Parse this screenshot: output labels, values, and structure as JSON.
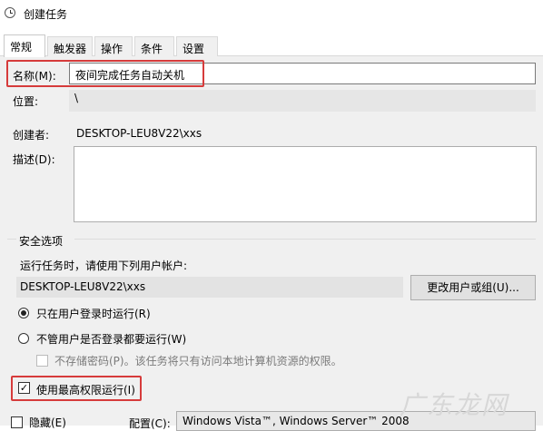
{
  "window": {
    "title": "创建任务"
  },
  "tabs": [
    {
      "label": "常规",
      "active": true
    },
    {
      "label": "触发器",
      "active": false
    },
    {
      "label": "操作",
      "active": false
    },
    {
      "label": "条件",
      "active": false
    },
    {
      "label": "设置",
      "active": false
    }
  ],
  "general": {
    "name_label": "名称(M):",
    "name_value": "夜间完成任务自动关机",
    "location_label": "位置:",
    "location_value": "\\",
    "author_label": "创建者:",
    "author_value": "DESKTOP-LEU8V22\\xxs",
    "description_label": "描述(D):",
    "description_value": ""
  },
  "security": {
    "group_label": "安全选项",
    "run_as_prompt": "运行任务时，请使用下列用户帐户:",
    "user_account": "DESKTOP-LEU8V22\\xxs",
    "change_user_button": "更改用户或组(U)...",
    "radio_logged_on": {
      "label": "只在用户登录时运行(R)",
      "selected": true
    },
    "radio_whether_logged": {
      "label": "不管用户是否登录都要运行(W)",
      "selected": false
    },
    "no_store_password": {
      "label": "不存储密码(P)。该任务将只有访问本地计算机资源的权限。",
      "checked": false,
      "enabled": false
    },
    "highest_privileges": {
      "label": "使用最高权限运行(I)",
      "checked": true
    }
  },
  "footer": {
    "hidden_label": "隐藏(E)",
    "configure_label": "配置(C):",
    "configure_value": "Windows Vista™, Windows Server™ 2008"
  },
  "watermark": {
    "text": "广东龙网"
  },
  "colors": {
    "highlight": "#d63b3b",
    "pane_bg": "#f0f0f0"
  }
}
